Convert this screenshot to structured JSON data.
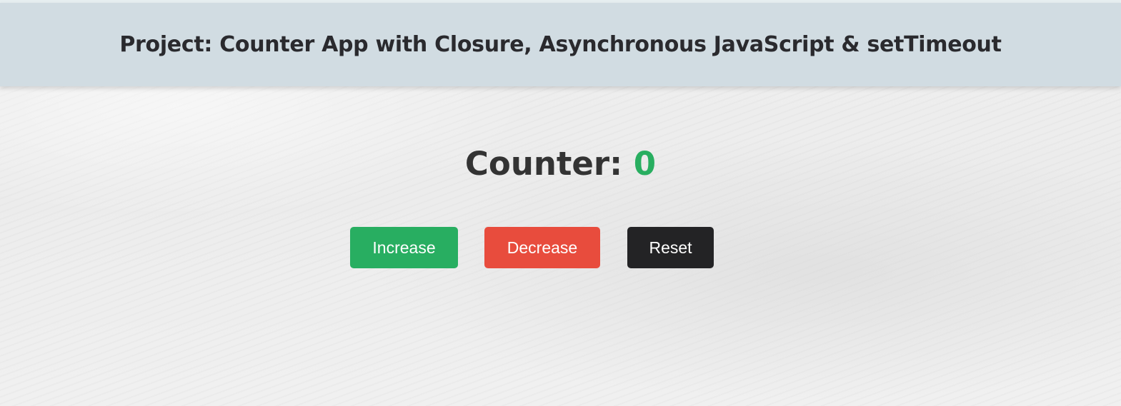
{
  "header": {
    "title": "Project: Counter App with Closure, Asynchronous JavaScript & setTimeout"
  },
  "counter": {
    "label": "Counter:",
    "value": "0"
  },
  "buttons": {
    "increase_label": "Increase",
    "decrease_label": "Decrease",
    "reset_label": "Reset"
  },
  "colors": {
    "header_bg": "#d1dce2",
    "counter_value": "#28ae60",
    "increase": "#28ae61",
    "decrease": "#e84c3d",
    "reset": "#232325"
  }
}
